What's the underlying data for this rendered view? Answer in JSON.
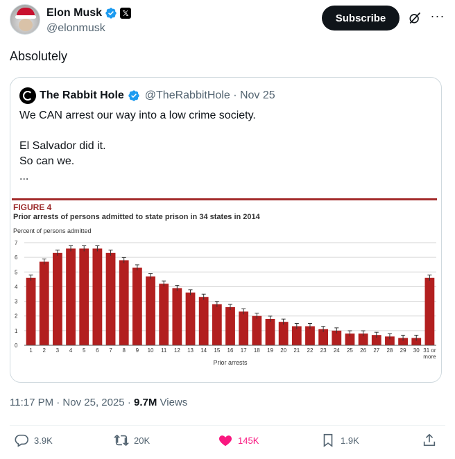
{
  "post": {
    "display_name": "Elon Musk",
    "handle": "@elonmusk",
    "subscribe_label": "Subscribe",
    "more_label": "···",
    "text": "Absolutely",
    "timestamp": "11:17 PM · Nov 25, 2025 · ",
    "views_count": "9.7M",
    "views_label": " Views"
  },
  "quote": {
    "display_name": "The Rabbit Hole",
    "handle_date": "@TheRabbitHole · Nov 25",
    "lines": [
      "We CAN arrest our way into a low crime society.",
      "El Salvador did it.",
      "So can we.",
      "..."
    ]
  },
  "actions": {
    "replies": "3.9K",
    "reposts": "20K",
    "likes": "145K",
    "bookmarks": "1.9K"
  },
  "icons": {
    "verified": "verified-badge-icon",
    "x_affiliate": "x-logo-icon",
    "grok": "grok-icon",
    "reply": "reply-icon",
    "repost": "repost-icon",
    "like": "heart-icon",
    "bookmark": "bookmark-icon",
    "share": "share-icon"
  },
  "colors": {
    "verified_blue": "#1d9bf0",
    "like_pink": "#f91880",
    "bar_red": "#b21f1f",
    "text_dark": "#0f1419",
    "text_muted": "#536471"
  },
  "chart_data": {
    "type": "bar",
    "label": "FIGURE 4",
    "title": "Prior arrests of persons admitted to state prison in 34 states in 2014",
    "ylabel": "Percent of persons admitted",
    "xlabel": "Prior arrests",
    "ylim": [
      0,
      7
    ],
    "yticks": [
      "0",
      "1",
      "2",
      "3",
      "4",
      "5",
      "6",
      "7"
    ],
    "grid": true,
    "categories": [
      "1",
      "2",
      "3",
      "4",
      "5",
      "6",
      "7",
      "8",
      "9",
      "10",
      "11",
      "12",
      "13",
      "14",
      "15",
      "16",
      "17",
      "18",
      "19",
      "20",
      "21",
      "22",
      "23",
      "24",
      "25",
      "26",
      "27",
      "28",
      "29",
      "30",
      "31 or more"
    ],
    "values": [
      4.6,
      5.7,
      6.3,
      6.6,
      6.6,
      6.6,
      6.3,
      5.8,
      5.3,
      4.7,
      4.2,
      3.9,
      3.6,
      3.3,
      2.8,
      2.6,
      2.3,
      2.0,
      1.8,
      1.6,
      1.3,
      1.3,
      1.1,
      1.0,
      0.8,
      0.8,
      0.7,
      0.6,
      0.5,
      0.5,
      4.6
    ]
  }
}
